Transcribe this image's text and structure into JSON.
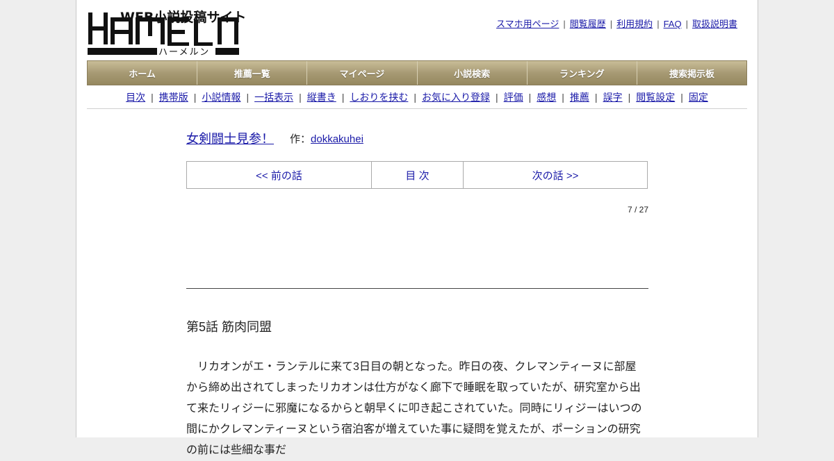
{
  "logo": {
    "tagline": "WEB小説投稿サイト",
    "wordmark": "HAMELN",
    "subtitle": "ハーメルン"
  },
  "toplinks": [
    "スマホ用ページ",
    "閲覧履歴",
    "利用規約",
    "FAQ",
    "取扱説明書"
  ],
  "nav": [
    "ホーム",
    "推薦一覧",
    "マイページ",
    "小説検索",
    "ランキング",
    "捜索掲示板"
  ],
  "subnav": [
    "目次",
    "携帯版",
    "小説情報",
    "一括表示",
    "縦書き",
    "しおりを挟む",
    "お気に入り登録",
    "評価",
    "感想",
    "推薦",
    "誤字",
    "閲覧設定",
    "固定"
  ],
  "novel": {
    "title": "女剣闘士見参！",
    "author_prefix": "作：",
    "author": "dokkakuhei"
  },
  "pager": {
    "prev": "<< 前の話",
    "toc": "目 次",
    "next": "次の話 >>"
  },
  "page_count": "7 / 27",
  "chapter_title": "第5話 筋肉同盟",
  "body": "　リカオンがエ・ランテルに来て3日目の朝となった。昨日の夜、クレマンティーヌに部屋から締め出されてしまったリカオンは仕方がなく廊下で睡眠を取っていたが、研究室から出て来たリィジーに邪魔になるからと朝早くに叩き起こされていた。同時にリィジーはいつの間にかクレマンティーヌという宿泊客が増えていた事に疑問を覚えたが、ポーションの研究の前には些細な事だ"
}
